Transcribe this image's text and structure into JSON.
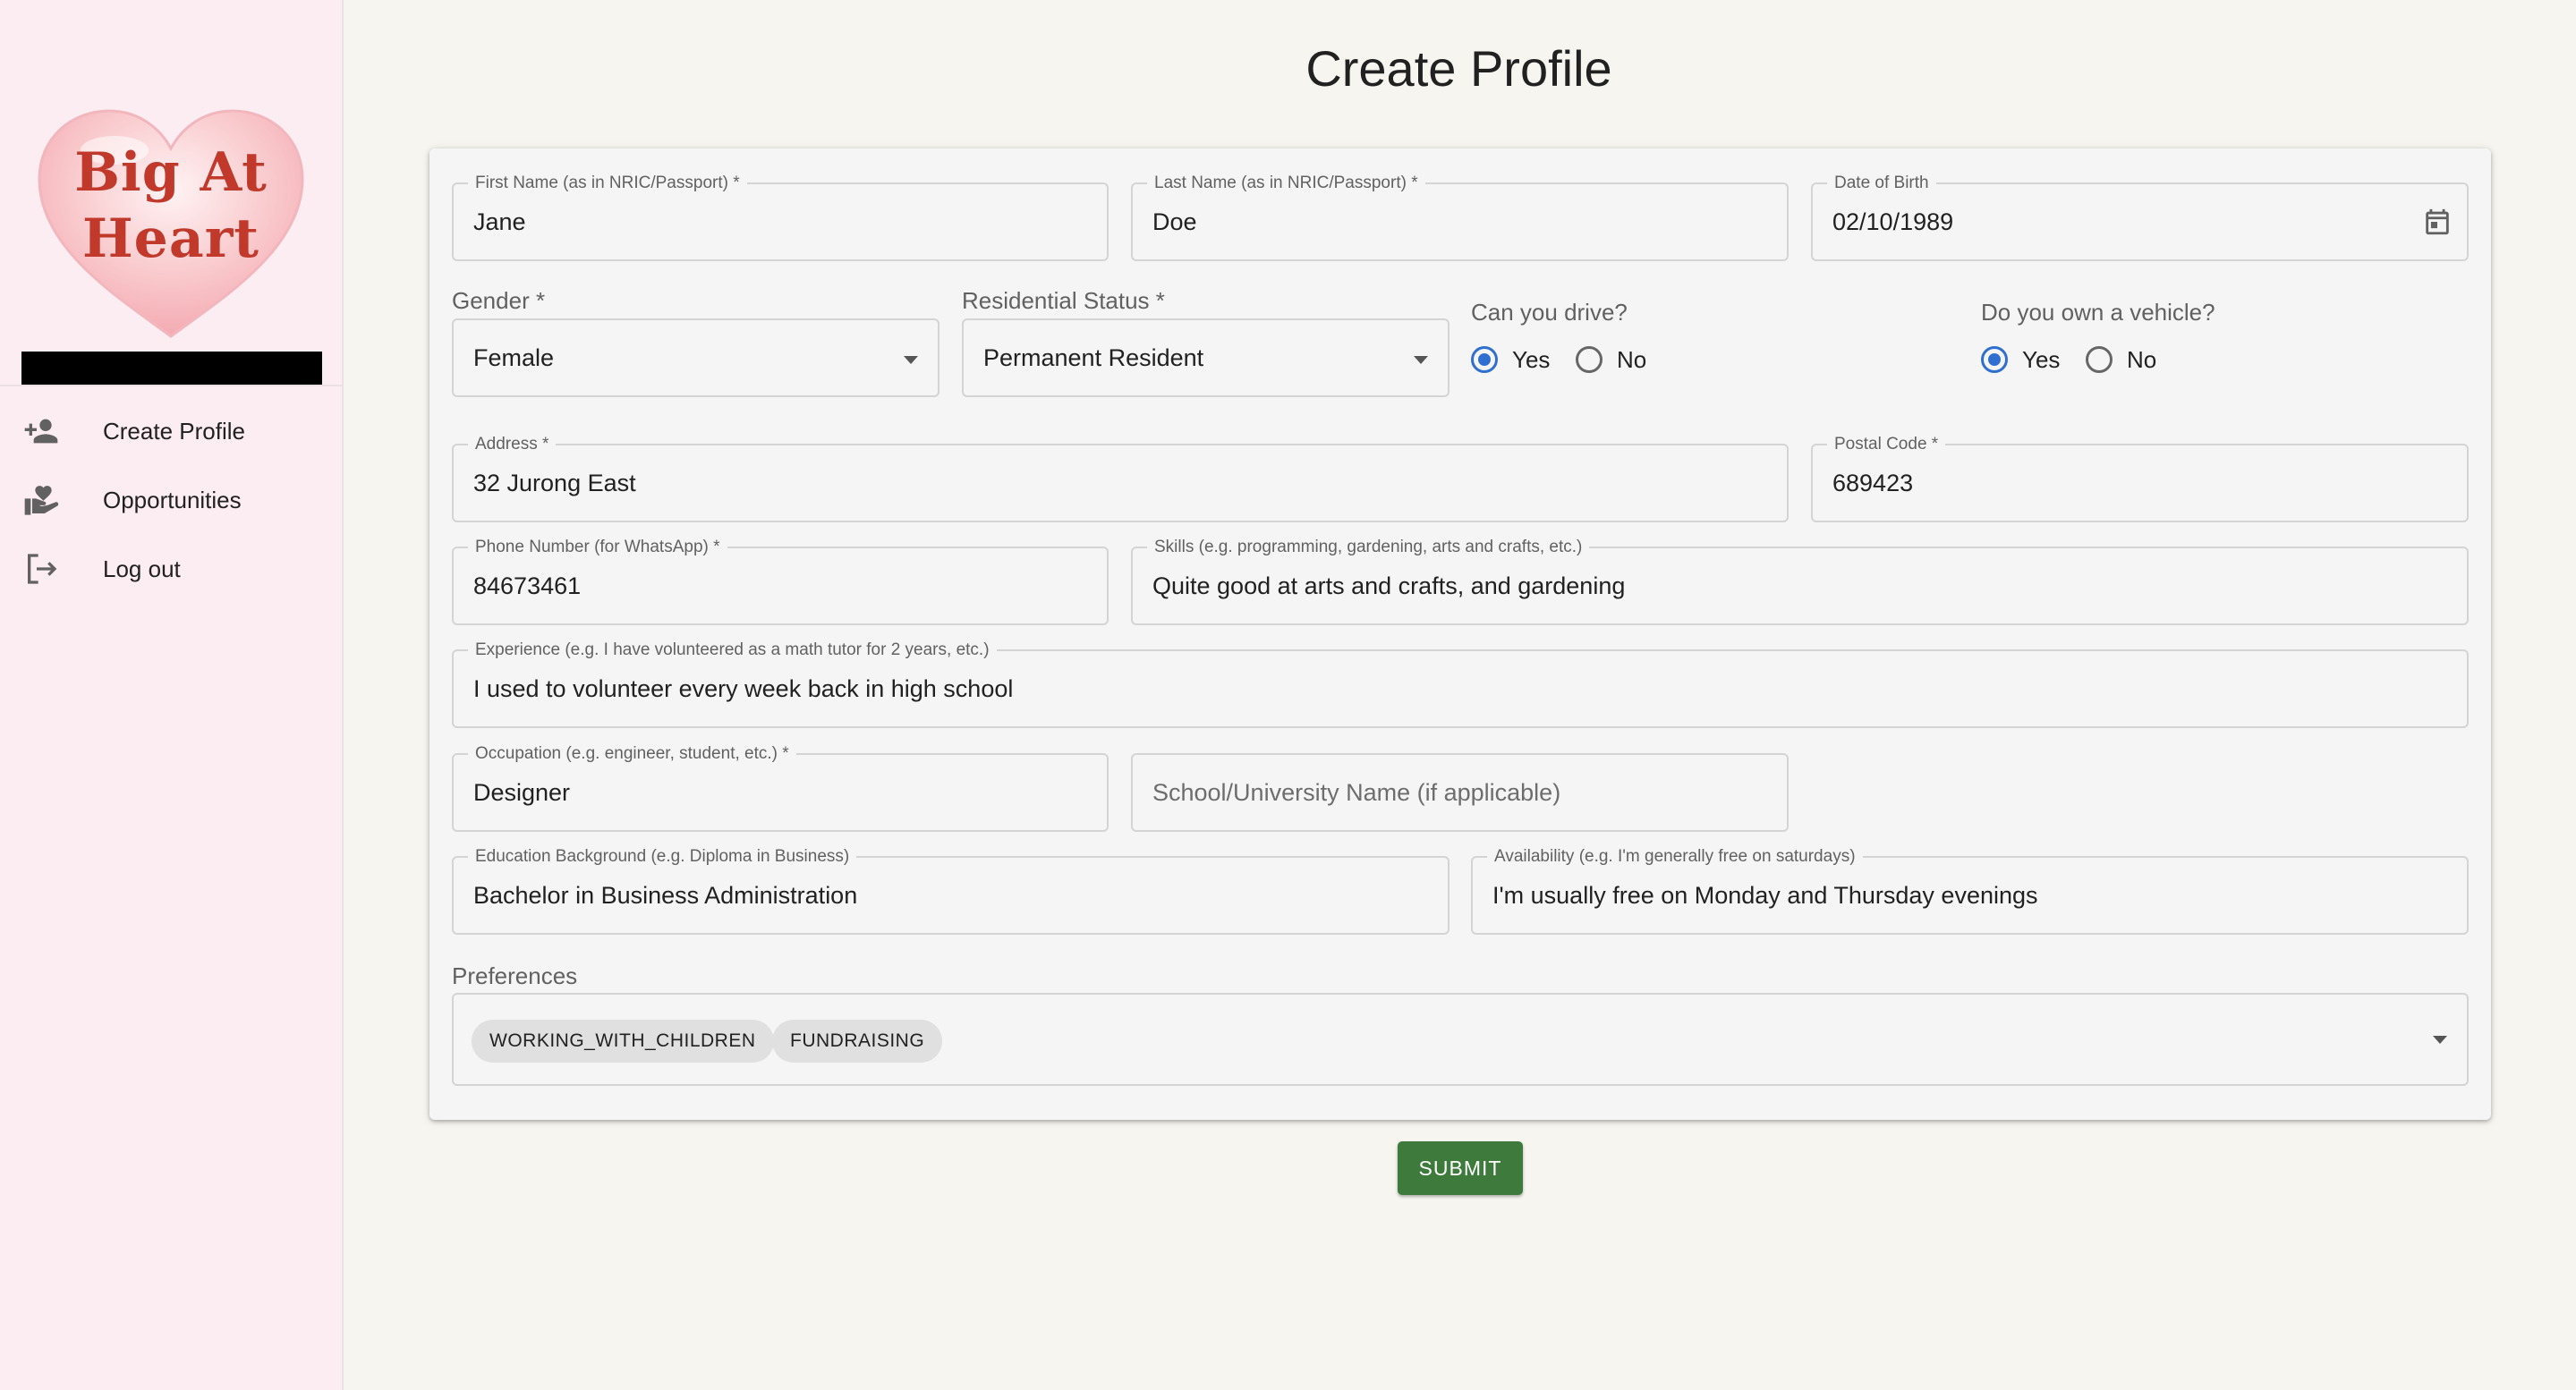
{
  "sidebar": {
    "logo_line1": "Big At",
    "logo_line2": "Heart",
    "items": [
      {
        "label": "Create Profile",
        "icon": "person-add-icon"
      },
      {
        "label": "Opportunities",
        "icon": "volunteer-hand-heart-icon"
      },
      {
        "label": "Log out",
        "icon": "logout-icon"
      }
    ]
  },
  "page": {
    "title": "Create Profile"
  },
  "form": {
    "first_name": {
      "label": "First Name (as in NRIC/Passport) *",
      "value": "Jane"
    },
    "last_name": {
      "label": "Last Name (as in NRIC/Passport) *",
      "value": "Doe"
    },
    "dob": {
      "label": "Date of Birth",
      "value": "02/10/1989"
    },
    "gender": {
      "label": "Gender *",
      "value": "Female"
    },
    "residential_status": {
      "label": "Residential Status *",
      "value": "Permanent Resident"
    },
    "can_drive": {
      "label": "Can you drive?",
      "yes": "Yes",
      "no": "No",
      "selected": "Yes"
    },
    "own_vehicle": {
      "label": "Do you own a vehicle?",
      "yes": "Yes",
      "no": "No",
      "selected": "Yes"
    },
    "address": {
      "label": "Address *",
      "value": "32 Jurong East"
    },
    "postal_code": {
      "label": "Postal Code *",
      "value": "689423"
    },
    "phone": {
      "label": "Phone Number (for WhatsApp) *",
      "value": "84673461"
    },
    "skills": {
      "label": "Skills (e.g. programming, gardening, arts and crafts, etc.)",
      "value": "Quite good at arts and crafts, and gardening"
    },
    "experience": {
      "label": "Experience (e.g. I have volunteered as a math tutor for 2 years, etc.)",
      "value": "I used to volunteer every week back in high school"
    },
    "occupation": {
      "label": "Occupation (e.g. engineer, student, etc.) *",
      "value": "Designer"
    },
    "school": {
      "placeholder": "School/University Name (if applicable)"
    },
    "education": {
      "label": "Education Background (e.g. Diploma in Business)",
      "value": "Bachelor in Business Administration"
    },
    "availability": {
      "label": "Availability (e.g. I'm generally free on saturdays)",
      "value": "I'm usually free on Monday and Thursday evenings"
    },
    "preferences": {
      "label": "Preferences",
      "chips": [
        "WORKING_WITH_CHILDREN",
        "FUNDRAISING"
      ]
    },
    "submit_label": "SUBMIT"
  },
  "colors": {
    "accent": "#2f6fcf",
    "submit": "#3d7a3c",
    "logo": "#c0392b"
  }
}
